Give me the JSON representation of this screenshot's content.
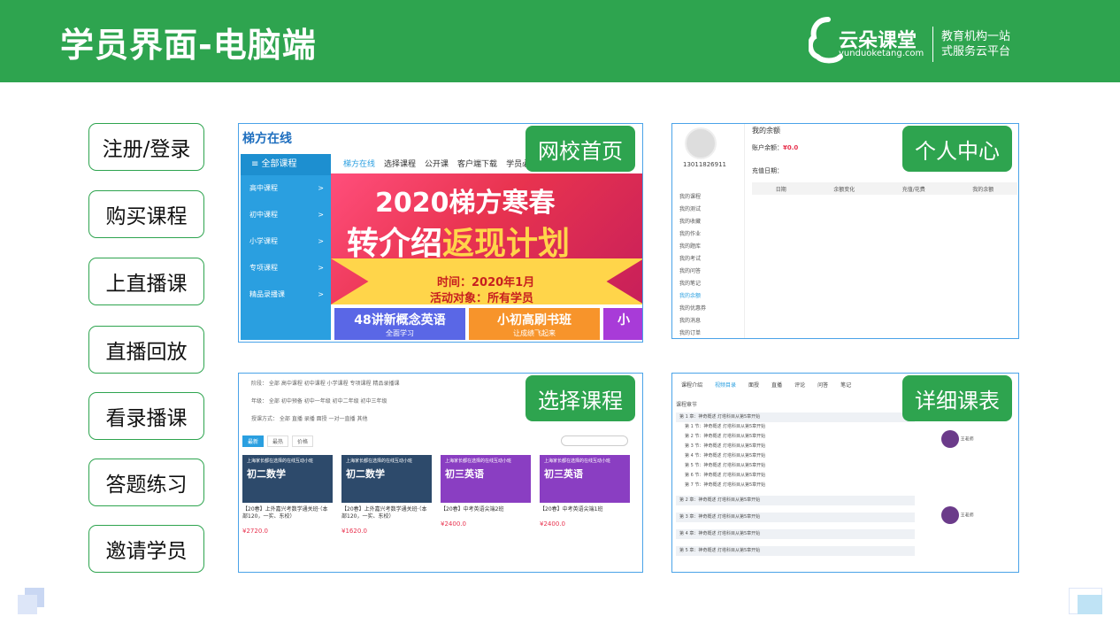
{
  "header": {
    "title": "学员界面-电脑端",
    "brand_name": "云朵课堂",
    "brand_url": "yunduoketang.com",
    "brand_slogan_1": "教育机构一站",
    "brand_slogan_2": "式服务云平台"
  },
  "nav": [
    "注册/登录",
    "购买课程",
    "上直播课",
    "直播回放",
    "看录播课",
    "答题练习",
    "邀请学员"
  ],
  "tags": {
    "home": "网校首页",
    "personal": "个人中心",
    "select": "选择课程",
    "schedule": "详细课表"
  },
  "home": {
    "logo": "梯方在线",
    "sidebar_head": "≡ 全部课程",
    "sidebar_items": [
      "高中课程",
      "初中课程",
      "小学课程",
      "专项课程",
      "精品录播课"
    ],
    "top_nav": [
      "梯方在线",
      "选择课程",
      "公开课",
      "客户端下载",
      "学员必"
    ],
    "banner_line1": "2020梯方寒春",
    "banner_line2a": "转介绍",
    "banner_line2b": "返现计划",
    "banner_time": "时间：2020年1月",
    "banner_target": "活动对象：所有学员",
    "cards": [
      {
        "title": "48讲新概念英语",
        "sub": "全面学习",
        "color": "#5a67e6"
      },
      {
        "title": "小初高刷书班",
        "sub": "让成绩飞起来",
        "color": "#f7942b"
      },
      {
        "title": "小",
        "sub": "",
        "color": "#a83bd8"
      }
    ]
  },
  "personal": {
    "phone": "13011826911",
    "menu": [
      "我的课程",
      "我的测试",
      "我的收藏",
      "我的作业",
      "我的题库",
      "我的考试",
      "我的问答",
      "我的笔记",
      "我的余额",
      "我的优惠券",
      "我的消息",
      "我的订单"
    ],
    "active_menu": "我的余额",
    "heading": "我的余额",
    "balance_label": "账户余额：",
    "balance_value": "¥0.0",
    "filter_label": "充值日期：",
    "columns": [
      "日期",
      "余额变化",
      "充值/花费",
      "我的余额"
    ]
  },
  "select": {
    "filters": [
      "阶段：  全部   高中课程   初中课程   小学课程   专项课程   精品录播课",
      "年级：  全部   初中预备   初中一年级   初中二年级   初中三年级",
      "授课方式：  全部   直播   录播   面授   一对一直播   其他"
    ],
    "tabs": [
      "最新",
      "最热",
      "价格"
    ],
    "courses": [
      {
        "head": "上海家长都在选择的在线互动小班",
        "big": "初二数学",
        "name": "【20春】上外嘉兴考数学通关班·（本部120，一实、东校）",
        "price": "¥2720.0",
        "color": "#2d4a6b"
      },
      {
        "head": "上海家长都在选择的在线互动小班",
        "big": "初二数学",
        "name": "【20春】上外嘉兴考数学通关班·（本部120，一实、东校）",
        "price": "¥1620.0",
        "color": "#2d4a6b"
      },
      {
        "head": "上海家长都在选择的在线互动小班",
        "big": "初三英语",
        "name": "【20春】中考英语尖端2班",
        "price": "¥2400.0",
        "color": "#8a3ec2"
      },
      {
        "head": "上海家长都在选择的在线互动小班",
        "big": "初三英语",
        "name": "【20春】中考英语尖端1班",
        "price": "¥2400.0",
        "color": "#8a3ec2"
      }
    ]
  },
  "schedule": {
    "tabs": [
      "课程介绍",
      "视频目录",
      "面授",
      "直播",
      "评论",
      "问答",
      "笔记"
    ],
    "active_tab": "视频目录",
    "section": "课程章节",
    "chapters": [
      "第 1 章：神奇概述  灯塔科目从第5章开始",
      "第 2 章：神奇概述  灯塔科目从第5章开始",
      "第 3 章：神奇概述  灯塔科目从第5章开始",
      "第 4 章：神奇概述  灯塔科目从第5章开始",
      "第 5 章：神奇概述  灯塔科目从第5章开始"
    ],
    "lessons": [
      "第 1 节：神奇概述  灯塔科目从第5章开始",
      "第 2 节：神奇概述  灯塔科目从第5章开始",
      "第 3 节：神奇概述  灯塔科目从第5章开始",
      "第 4 节：神奇概述  灯塔科目从第5章开始",
      "第 5 节：神奇概述  灯塔科目从第5章开始",
      "第 6 节：神奇概述  灯塔科目从第5章开始",
      "第 7 节：神奇概述  灯塔科目从第5章开始"
    ],
    "teacher": "王老师"
  }
}
